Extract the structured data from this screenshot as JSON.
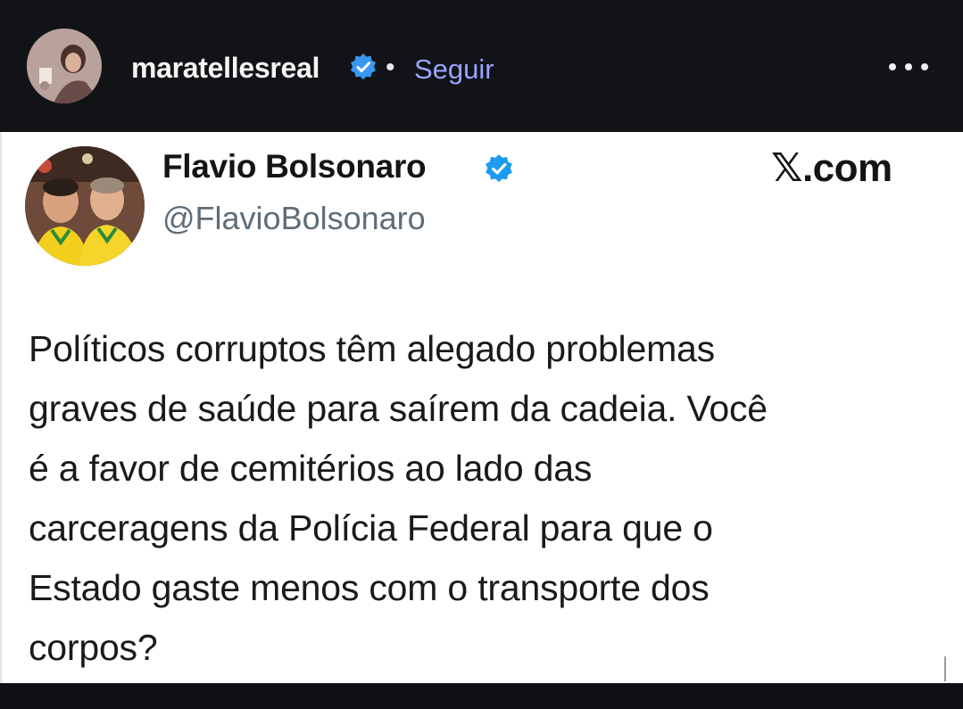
{
  "instagram": {
    "username": "maratellesreal",
    "separator": "•",
    "follow_label": "Seguir",
    "more_icon": "more-horizontal-icon",
    "verified_color": "#3897f0",
    "follow_color": "#9aa4ff"
  },
  "tweet": {
    "display_name": "Flavio Bolsonaro",
    "handle": "@FlavioBolsonaro",
    "brand": "𝕏.com",
    "verified_color": "#1d9bf0",
    "body_lines": [
      "Políticos corruptos têm alegado problemas",
      "graves de saúde para saírem da cadeia. Você",
      "é a favor de cemitérios ao lado das",
      "carceragens da Polícia Federal para que o",
      "Estado gaste menos com o transporte dos",
      "corpos?"
    ]
  }
}
